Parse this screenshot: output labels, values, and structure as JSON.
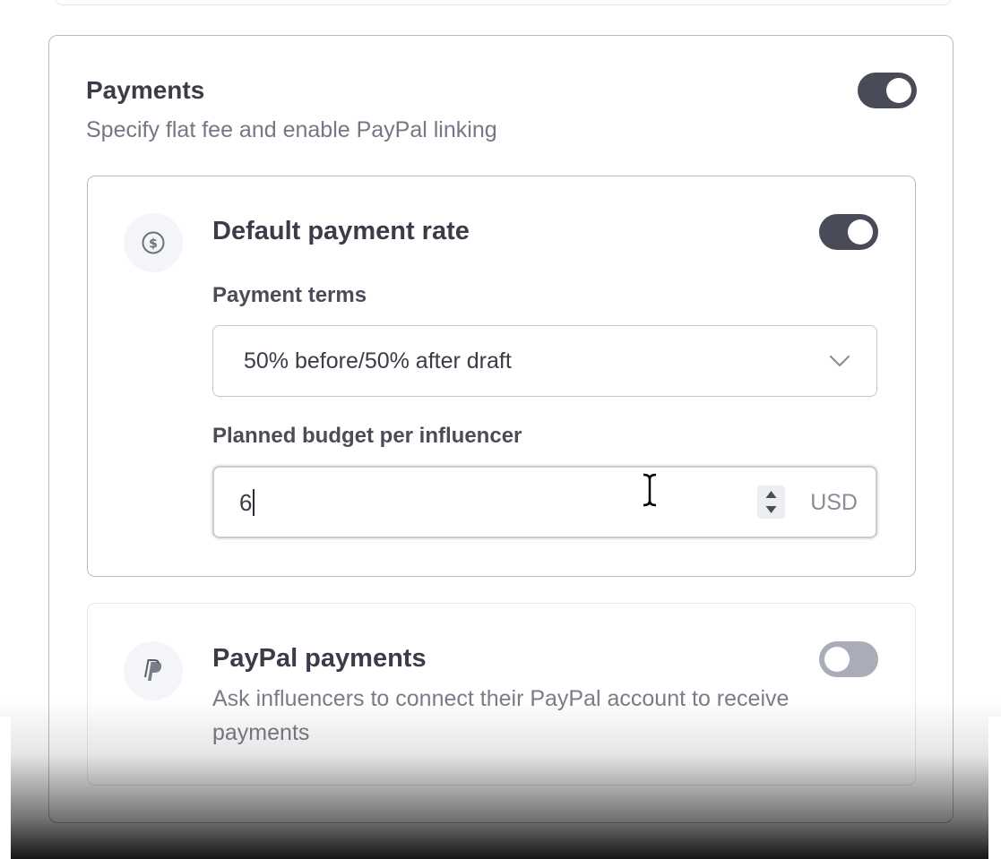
{
  "payments": {
    "title": "Payments",
    "subtitle": "Specify flat fee and enable PayPal linking",
    "enabled": true
  },
  "default_rate": {
    "title": "Default payment rate",
    "icon": "dollar-circle-icon",
    "enabled": true,
    "terms_label": "Payment terms",
    "terms_value": "50% before/50% after draft",
    "budget_label": "Planned budget per influencer",
    "budget_value": "6",
    "budget_unit": "USD"
  },
  "paypal": {
    "title": "PayPal payments",
    "icon": "paypal-icon",
    "enabled": false,
    "description": "Ask influencers to connect their PayPal account to receive payments"
  },
  "colors": {
    "toggle_on": "#4a4b58",
    "toggle_off": "#a9adb8",
    "border": "#b9bbc4"
  }
}
